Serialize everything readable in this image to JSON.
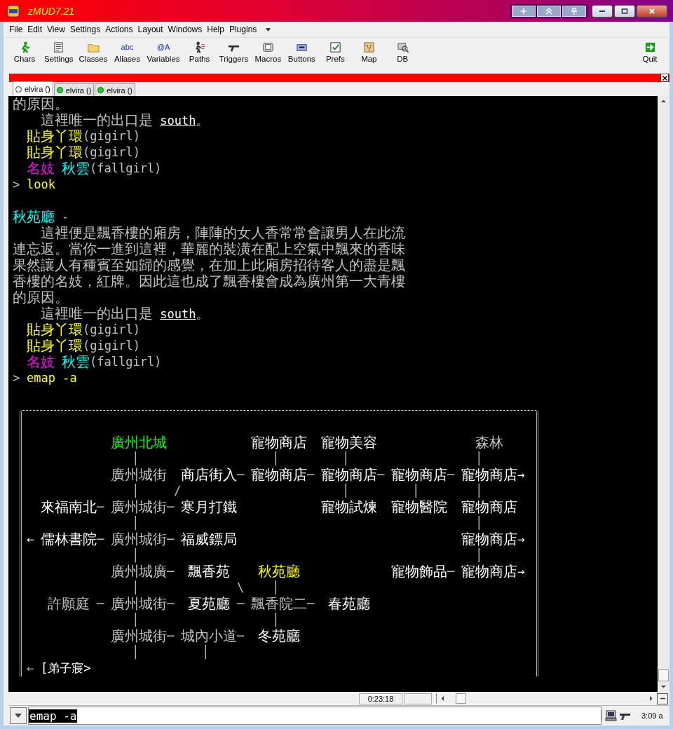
{
  "window": {
    "title": "zMUD7.21"
  },
  "menu": [
    {
      "label": "File"
    },
    {
      "label": "Edit"
    },
    {
      "label": "View"
    },
    {
      "label": "Settings"
    },
    {
      "label": "Actions"
    },
    {
      "label": "Layout"
    },
    {
      "label": "Windows"
    },
    {
      "label": "Help"
    },
    {
      "label": "Plugins"
    }
  ],
  "toolbar": [
    {
      "label": "Chars",
      "kind": "chars"
    },
    {
      "label": "Settings",
      "kind": "settings"
    },
    {
      "label": "Classes",
      "kind": "classes"
    },
    {
      "label": "Aliases",
      "kind": "glyph",
      "glyph": "abc"
    },
    {
      "label": "Variables",
      "kind": "glyph",
      "glyph": "@A"
    },
    {
      "label": "Paths",
      "kind": "paths"
    },
    {
      "label": "Triggers",
      "kind": "triggers"
    },
    {
      "label": "Macros",
      "kind": "macros"
    },
    {
      "label": "Buttons",
      "kind": "buttons"
    },
    {
      "label": "Prefs",
      "kind": "prefs"
    },
    {
      "label": "Map",
      "kind": "map"
    },
    {
      "label": "DB",
      "kind": "db"
    }
  ],
  "quit": {
    "label": "Quit"
  },
  "tabs": [
    {
      "label": "elvira ()",
      "selected": true,
      "connected": false
    },
    {
      "label": "elvira ()",
      "selected": false,
      "connected": true
    },
    {
      "label": "elvira ()",
      "selected": false,
      "connected": true
    }
  ],
  "terminal": {
    "lines": [
      {
        "kind": "output",
        "segments": [
          {
            "text": "的原因。",
            "color": "#c0c0c0",
            "kind": "text"
          }
        ]
      },
      {
        "kind": "output",
        "segments": [
          {
            "text": "    這裡唯一的出口是",
            "color": "#c0c0c0",
            "kind": "text"
          },
          {
            "text": " south",
            "color": "#ffffff",
            "kind": "link"
          },
          {
            "text": "。",
            "color": "#c0c0c0",
            "kind": "text"
          }
        ]
      },
      {
        "kind": "output",
        "segments": [
          {
            "text": "  貼身丫環",
            "color": "#ffff00",
            "kind": "text"
          },
          {
            "text": "(gigirl)",
            "color": "#c0c0c0",
            "kind": "text"
          }
        ]
      },
      {
        "kind": "output",
        "segments": [
          {
            "text": "  貼身丫環",
            "color": "#ffff00",
            "kind": "text"
          },
          {
            "text": "(gigirl)",
            "color": "#c0c0c0",
            "kind": "text"
          }
        ]
      },
      {
        "kind": "output",
        "segments": [
          {
            "text": "  名妓",
            "color": "#ff00ff",
            "kind": "text"
          },
          {
            "text": " 秋雲",
            "color": "#00ffff",
            "kind": "text"
          },
          {
            "text": "(fallgirl)",
            "color": "#c0c0c0",
            "kind": "text"
          }
        ]
      },
      {
        "kind": "output",
        "segments": [
          {
            "text": ">",
            "color": "#c0c0c0",
            "kind": "text"
          },
          {
            "text": " look",
            "color": "#ffff00",
            "kind": "text"
          }
        ]
      },
      {
        "kind": "blank"
      },
      {
        "kind": "output",
        "segments": [
          {
            "text": "秋苑廳",
            "color": "#00ffff",
            "kind": "text"
          },
          {
            "text": " -",
            "color": "#c0c0c0",
            "kind": "text"
          }
        ]
      },
      {
        "kind": "output",
        "segments": [
          {
            "text": "    這裡便是飄香樓的廂房，陣陣的女人香常常會讓男人在此流",
            "color": "#c0c0c0",
            "kind": "text"
          }
        ]
      },
      {
        "kind": "output",
        "segments": [
          {
            "text": "連忘返。當你一進到這裡，華麗的裝潢在配上空氣中飄來的香味",
            "color": "#c0c0c0",
            "kind": "text"
          }
        ]
      },
      {
        "kind": "output",
        "segments": [
          {
            "text": "果然讓人有種賓至如歸的感覺，在加上此廂房招待客人的盡是飄",
            "color": "#c0c0c0",
            "kind": "text"
          }
        ]
      },
      {
        "kind": "output",
        "segments": [
          {
            "text": "香樓的名妓，紅牌。因此這也成了飄香樓會成為廣州第一大青樓",
            "color": "#c0c0c0",
            "kind": "text"
          }
        ]
      },
      {
        "kind": "output",
        "segments": [
          {
            "text": "的原因。",
            "color": "#c0c0c0",
            "kind": "text"
          }
        ]
      },
      {
        "kind": "output",
        "segments": [
          {
            "text": "    這裡唯一的出口是",
            "color": "#c0c0c0",
            "kind": "text"
          },
          {
            "text": " south",
            "color": "#ffffff",
            "kind": "link"
          },
          {
            "text": "。",
            "color": "#c0c0c0",
            "kind": "text"
          }
        ]
      },
      {
        "kind": "output",
        "segments": [
          {
            "text": "  貼身丫環",
            "color": "#ffff00",
            "kind": "text"
          },
          {
            "text": "(gigirl)",
            "color": "#c0c0c0",
            "kind": "text"
          }
        ]
      },
      {
        "kind": "output",
        "segments": [
          {
            "text": "  貼身丫環",
            "color": "#ffff00",
            "kind": "text"
          },
          {
            "text": "(gigirl)",
            "color": "#c0c0c0",
            "kind": "text"
          }
        ]
      },
      {
        "kind": "output",
        "segments": [
          {
            "text": "  名妓",
            "color": "#ff00ff",
            "kind": "text"
          },
          {
            "text": " 秋雲",
            "color": "#00ffff",
            "kind": "text"
          },
          {
            "text": "(fallgirl)",
            "color": "#c0c0c0",
            "kind": "text"
          }
        ]
      },
      {
        "kind": "output",
        "segments": [
          {
            "text": ">",
            "color": "#c0c0c0",
            "kind": "text"
          },
          {
            "text": " emap -a",
            "color": "#ffff00",
            "kind": "text"
          }
        ]
      }
    ]
  },
  "map": {
    "lines": [
      {
        "segments": [
          {
            "text": "            廣州北城",
            "color": "#00ff00"
          },
          {
            "text": "            寵物商店",
            "color": "#ffffff"
          },
          {
            "text": "  寵物美容",
            "color": "#ffffff"
          },
          {
            "text": "              森林",
            "color": "#c0c0c0"
          }
        ]
      },
      {
        "segments": [
          {
            "text": "               │",
            "color": "#c0c0c0"
          },
          {
            "text": "                   │",
            "color": "#c0c0c0"
          },
          {
            "text": "         │",
            "color": "#c0c0c0"
          },
          {
            "text": "                  │",
            "color": "#c0c0c0"
          }
        ]
      },
      {
        "segments": [
          {
            "text": "            廣州城街",
            "color": "#c0c0c0"
          },
          {
            "text": "  商店街入",
            "color": "#ffffff"
          },
          {
            "text": "─",
            "color": "#c0c0c0"
          },
          {
            "text": "寵物商店",
            "color": "#ffffff"
          },
          {
            "text": "─",
            "color": "#c0c0c0"
          },
          {
            "text": "寵物商店",
            "color": "#ffffff"
          },
          {
            "text": "─",
            "color": "#c0c0c0"
          },
          {
            "text": "寵物商店",
            "color": "#ffffff"
          },
          {
            "text": "─",
            "color": "#c0c0c0"
          },
          {
            "text": "寵物商店",
            "color": "#ffffff"
          },
          {
            "text": "→",
            "color": "#ffffff"
          }
        ]
      },
      {
        "segments": [
          {
            "text": "               │",
            "color": "#c0c0c0"
          },
          {
            "text": "     /",
            "color": "#c0c0c0"
          },
          {
            "text": "                       │",
            "color": "#c0c0c0"
          },
          {
            "text": "         │",
            "color": "#c0c0c0"
          },
          {
            "text": "        │",
            "color": "#c0c0c0"
          }
        ]
      },
      {
        "segments": [
          {
            "text": "  來福南北",
            "color": "#ffffff"
          },
          {
            "text": "─",
            "color": "#c0c0c0"
          },
          {
            "text": "廣州城街",
            "color": "#c0c0c0"
          },
          {
            "text": "─",
            "color": "#c0c0c0"
          },
          {
            "text": "寒月打鐵",
            "color": "#ffffff"
          },
          {
            "text": "            寵物試煉",
            "color": "#ffffff"
          },
          {
            "text": "  寵物醫院",
            "color": "#ffffff"
          },
          {
            "text": "  寵物商店",
            "color": "#ffffff"
          }
        ]
      },
      {
        "segments": [
          {
            "text": "               │",
            "color": "#c0c0c0"
          },
          {
            "text": "                                                │",
            "color": "#c0c0c0"
          }
        ]
      },
      {
        "segments": [
          {
            "text": "←",
            "color": "#ffffff"
          },
          {
            "text": "儒林書院",
            "color": "#ffffff"
          },
          {
            "text": "─",
            "color": "#c0c0c0"
          },
          {
            "text": "廣州城街",
            "color": "#c0c0c0"
          },
          {
            "text": "─",
            "color": "#c0c0c0"
          },
          {
            "text": "福威鏢局",
            "color": "#ffffff"
          },
          {
            "text": "                                寵物商店",
            "color": "#ffffff"
          },
          {
            "text": "→",
            "color": "#ffffff"
          }
        ]
      },
      {
        "segments": [
          {
            "text": "               │",
            "color": "#c0c0c0"
          },
          {
            "text": "                                                │",
            "color": "#c0c0c0"
          }
        ]
      },
      {
        "segments": [
          {
            "text": "            廣州城廣",
            "color": "#c0c0c0"
          },
          {
            "text": "─",
            "color": "#c0c0c0"
          },
          {
            "text": " 飄香苑",
            "color": "#ffffff"
          },
          {
            "text": "    秋苑廳",
            "color": "#ffff00"
          },
          {
            "text": "             寵物飾品",
            "color": "#ffffff"
          },
          {
            "text": "─",
            "color": "#c0c0c0"
          },
          {
            "text": "寵物商店",
            "color": "#ffffff"
          },
          {
            "text": "→",
            "color": "#ffffff"
          }
        ]
      },
      {
        "segments": [
          {
            "text": "               │",
            "color": "#c0c0c0"
          },
          {
            "text": "              \\",
            "color": "#c0c0c0"
          },
          {
            "text": "    │",
            "color": "#c0c0c0"
          }
        ]
      },
      {
        "segments": [
          {
            "text": "   許願庭",
            "color": "#c0c0c0"
          },
          {
            "text": " ─",
            "color": "#c0c0c0"
          },
          {
            "text": "廣州城街",
            "color": "#c0c0c0"
          },
          {
            "text": "─",
            "color": "#c0c0c0"
          },
          {
            "text": " 夏苑廳",
            "color": "#ffffff"
          },
          {
            "text": " ─",
            "color": "#c0c0c0"
          },
          {
            "text": "飄香院二",
            "color": "#c0c0c0"
          },
          {
            "text": "─",
            "color": "#c0c0c0"
          },
          {
            "text": " 春苑廳",
            "color": "#ffffff"
          }
        ]
      },
      {
        "segments": [
          {
            "text": "               │",
            "color": "#c0c0c0"
          },
          {
            "text": "                   │",
            "color": "#c0c0c0"
          }
        ]
      },
      {
        "segments": [
          {
            "text": "            廣州城街",
            "color": "#c0c0c0"
          },
          {
            "text": "─",
            "color": "#c0c0c0"
          },
          {
            "text": "城內小道",
            "color": "#c0c0c0"
          },
          {
            "text": "─",
            "color": "#c0c0c0"
          },
          {
            "text": " 冬苑廳",
            "color": "#ffffff"
          }
        ]
      },
      {
        "segments": [
          {
            "text": "               │",
            "color": "#c0c0c0"
          },
          {
            "text": "         │",
            "color": "#c0c0c0"
          }
        ]
      },
      {
        "segments": [
          {
            "text": "←",
            "color": "#c0c0c0"
          },
          {
            "text": "[弟子寢>",
            "color": "#ffffff"
          }
        ]
      }
    ]
  },
  "status": {
    "timer": "0:23:18"
  },
  "input": {
    "value": "emap -a"
  },
  "clock": "3:09 a"
}
